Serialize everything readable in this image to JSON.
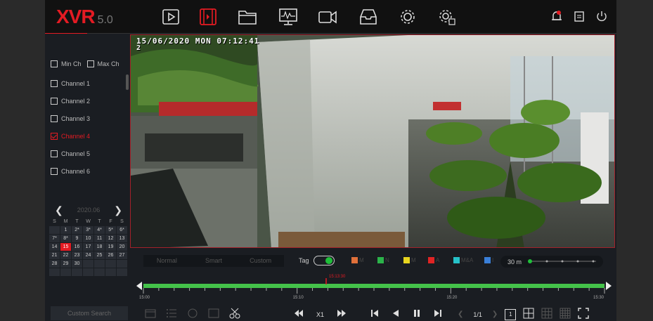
{
  "app": {
    "logo": "XVR",
    "version": "5.0"
  },
  "nav_icons": [
    "play-icon",
    "playback-icon",
    "folder-icon",
    "monitor-icon",
    "camera-icon",
    "inbox-icon",
    "gear-icon",
    "settings-gear-icon"
  ],
  "top_right_icons": [
    "alarm-icon",
    "document-icon",
    "power-icon"
  ],
  "left": {
    "min_ch": "Min Ch",
    "max_ch": "Max Ch",
    "channels": [
      {
        "label": "Channel 1",
        "checked": false
      },
      {
        "label": "Channel 2",
        "checked": false
      },
      {
        "label": "Channel 3",
        "checked": false
      },
      {
        "label": "Channel 4",
        "checked": true
      },
      {
        "label": "Channel 5",
        "checked": false
      },
      {
        "label": "Channel 6",
        "checked": false
      }
    ],
    "calendar": {
      "month": "2020.06",
      "dow": [
        "S",
        "M",
        "T",
        "W",
        "T",
        "F",
        "S"
      ],
      "days": [
        "",
        "1",
        "2*",
        "3*",
        "4*",
        "5*",
        "6*",
        "7*",
        "8*",
        "9",
        "10",
        "11",
        "12",
        "13",
        "14",
        "15",
        "16",
        "17",
        "18",
        "19",
        "20",
        "21",
        "22",
        "23",
        "24",
        "25",
        "26",
        "27",
        "28",
        "29",
        "30",
        "",
        "",
        "",
        "",
        "",
        "",
        "",
        "",
        "",
        "",
        ""
      ],
      "today": "15"
    },
    "custom_search": "Custom Search"
  },
  "video": {
    "osd": "15/06/2020 MON 07:12:41",
    "osd_channel": "2"
  },
  "controls": {
    "modes": [
      "Normal",
      "Smart",
      "Custom"
    ],
    "tag_label": "Tag",
    "legend": [
      {
        "label": "M",
        "color": "#e0703a"
      },
      {
        "label": "N",
        "color": "#2bb34a"
      },
      {
        "label": "M",
        "color": "#e8d51f"
      },
      {
        "label": "A",
        "color": "#e02424"
      },
      {
        "label": "M&A",
        "color": "#26c2c9"
      },
      {
        "label": "I",
        "color": "#3a7fd8"
      }
    ],
    "zoom": "30 m",
    "time_marker": "15:13:30",
    "time_labels": [
      "15:00",
      "15:10",
      "15:20",
      "15:30"
    ],
    "speed": "X1",
    "page": "1/1",
    "layout_one": "1"
  },
  "colors": {
    "accent": "#e41b23",
    "timeline": "#44c24a"
  }
}
